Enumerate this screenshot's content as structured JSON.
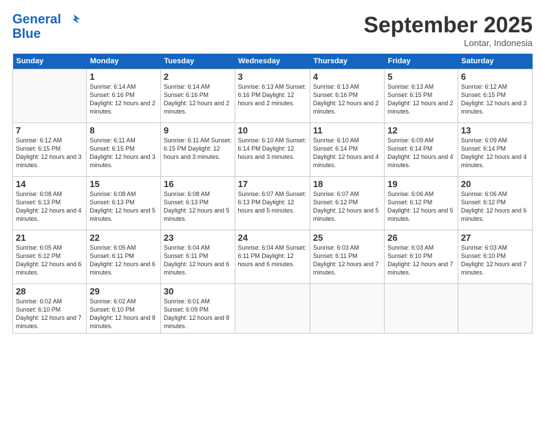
{
  "logo": {
    "line1": "General",
    "line2": "Blue"
  },
  "title": "September 2025",
  "location": "Lontar, Indonesia",
  "days_header": [
    "Sunday",
    "Monday",
    "Tuesday",
    "Wednesday",
    "Thursday",
    "Friday",
    "Saturday"
  ],
  "weeks": [
    [
      {
        "day": "",
        "info": ""
      },
      {
        "day": "1",
        "info": "Sunrise: 6:14 AM\nSunset: 6:16 PM\nDaylight: 12 hours\nand 2 minutes."
      },
      {
        "day": "2",
        "info": "Sunrise: 6:14 AM\nSunset: 6:16 PM\nDaylight: 12 hours\nand 2 minutes."
      },
      {
        "day": "3",
        "info": "Sunrise: 6:13 AM\nSunset: 6:16 PM\nDaylight: 12 hours\nand 2 minutes."
      },
      {
        "day": "4",
        "info": "Sunrise: 6:13 AM\nSunset: 6:16 PM\nDaylight: 12 hours\nand 2 minutes."
      },
      {
        "day": "5",
        "info": "Sunrise: 6:13 AM\nSunset: 6:15 PM\nDaylight: 12 hours\nand 2 minutes."
      },
      {
        "day": "6",
        "info": "Sunrise: 6:12 AM\nSunset: 6:15 PM\nDaylight: 12 hours\nand 3 minutes."
      }
    ],
    [
      {
        "day": "7",
        "info": "Sunrise: 6:12 AM\nSunset: 6:15 PM\nDaylight: 12 hours\nand 3 minutes."
      },
      {
        "day": "8",
        "info": "Sunrise: 6:11 AM\nSunset: 6:15 PM\nDaylight: 12 hours\nand 3 minutes."
      },
      {
        "day": "9",
        "info": "Sunrise: 6:11 AM\nSunset: 6:15 PM\nDaylight: 12 hours\nand 3 minutes."
      },
      {
        "day": "10",
        "info": "Sunrise: 6:10 AM\nSunset: 6:14 PM\nDaylight: 12 hours\nand 3 minutes."
      },
      {
        "day": "11",
        "info": "Sunrise: 6:10 AM\nSunset: 6:14 PM\nDaylight: 12 hours\nand 4 minutes."
      },
      {
        "day": "12",
        "info": "Sunrise: 6:09 AM\nSunset: 6:14 PM\nDaylight: 12 hours\nand 4 minutes."
      },
      {
        "day": "13",
        "info": "Sunrise: 6:09 AM\nSunset: 6:14 PM\nDaylight: 12 hours\nand 4 minutes."
      }
    ],
    [
      {
        "day": "14",
        "info": "Sunrise: 6:08 AM\nSunset: 6:13 PM\nDaylight: 12 hours\nand 4 minutes."
      },
      {
        "day": "15",
        "info": "Sunrise: 6:08 AM\nSunset: 6:13 PM\nDaylight: 12 hours\nand 5 minutes."
      },
      {
        "day": "16",
        "info": "Sunrise: 6:08 AM\nSunset: 6:13 PM\nDaylight: 12 hours\nand 5 minutes."
      },
      {
        "day": "17",
        "info": "Sunrise: 6:07 AM\nSunset: 6:13 PM\nDaylight: 12 hours\nand 5 minutes."
      },
      {
        "day": "18",
        "info": "Sunrise: 6:07 AM\nSunset: 6:12 PM\nDaylight: 12 hours\nand 5 minutes."
      },
      {
        "day": "19",
        "info": "Sunrise: 6:06 AM\nSunset: 6:12 PM\nDaylight: 12 hours\nand 5 minutes."
      },
      {
        "day": "20",
        "info": "Sunrise: 6:06 AM\nSunset: 6:12 PM\nDaylight: 12 hours\nand 6 minutes."
      }
    ],
    [
      {
        "day": "21",
        "info": "Sunrise: 6:05 AM\nSunset: 6:12 PM\nDaylight: 12 hours\nand 6 minutes."
      },
      {
        "day": "22",
        "info": "Sunrise: 6:05 AM\nSunset: 6:11 PM\nDaylight: 12 hours\nand 6 minutes."
      },
      {
        "day": "23",
        "info": "Sunrise: 6:04 AM\nSunset: 6:11 PM\nDaylight: 12 hours\nand 6 minutes."
      },
      {
        "day": "24",
        "info": "Sunrise: 6:04 AM\nSunset: 6:11 PM\nDaylight: 12 hours\nand 6 minutes."
      },
      {
        "day": "25",
        "info": "Sunrise: 6:03 AM\nSunset: 6:11 PM\nDaylight: 12 hours\nand 7 minutes."
      },
      {
        "day": "26",
        "info": "Sunrise: 6:03 AM\nSunset: 6:10 PM\nDaylight: 12 hours\nand 7 minutes."
      },
      {
        "day": "27",
        "info": "Sunrise: 6:03 AM\nSunset: 6:10 PM\nDaylight: 12 hours\nand 7 minutes."
      }
    ],
    [
      {
        "day": "28",
        "info": "Sunrise: 6:02 AM\nSunset: 6:10 PM\nDaylight: 12 hours\nand 7 minutes."
      },
      {
        "day": "29",
        "info": "Sunrise: 6:02 AM\nSunset: 6:10 PM\nDaylight: 12 hours\nand 8 minutes."
      },
      {
        "day": "30",
        "info": "Sunrise: 6:01 AM\nSunset: 6:09 PM\nDaylight: 12 hours\nand 8 minutes."
      },
      {
        "day": "",
        "info": ""
      },
      {
        "day": "",
        "info": ""
      },
      {
        "day": "",
        "info": ""
      },
      {
        "day": "",
        "info": ""
      }
    ]
  ]
}
